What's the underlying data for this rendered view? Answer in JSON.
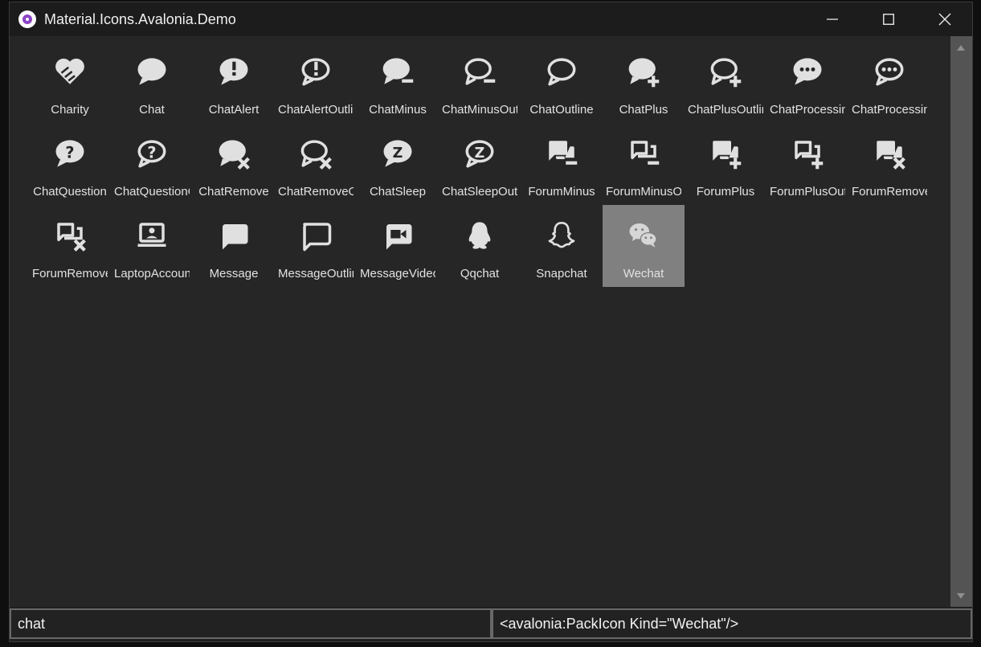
{
  "window": {
    "title": "Material.Icons.Avalonia.Demo",
    "controls": [
      "minimize",
      "maximize",
      "close"
    ]
  },
  "icons": [
    {
      "label": "Charity",
      "icon": "charity-icon"
    },
    {
      "label": "Chat",
      "icon": "chat-icon"
    },
    {
      "label": "ChatAlert",
      "icon": "chat-alert-icon"
    },
    {
      "label": "ChatAlertOutline",
      "icon": "chat-alert-outline-icon"
    },
    {
      "label": "ChatMinus",
      "icon": "chat-minus-icon"
    },
    {
      "label": "ChatMinusOutline",
      "icon": "chat-minus-outline-icon"
    },
    {
      "label": "ChatOutline",
      "icon": "chat-outline-icon"
    },
    {
      "label": "ChatPlus",
      "icon": "chat-plus-icon"
    },
    {
      "label": "ChatPlusOutline",
      "icon": "chat-plus-outline-icon"
    },
    {
      "label": "ChatProcessing",
      "icon": "chat-processing-icon"
    },
    {
      "label": "ChatProcessingOutline",
      "icon": "chat-processing-outline-icon"
    },
    {
      "label": "ChatQuestion",
      "icon": "chat-question-icon"
    },
    {
      "label": "ChatQuestionOutline",
      "icon": "chat-question-outline-icon"
    },
    {
      "label": "ChatRemove",
      "icon": "chat-remove-icon"
    },
    {
      "label": "ChatRemoveOutline",
      "icon": "chat-remove-outline-icon"
    },
    {
      "label": "ChatSleep",
      "icon": "chat-sleep-icon"
    },
    {
      "label": "ChatSleepOutline",
      "icon": "chat-sleep-outline-icon"
    },
    {
      "label": "ForumMinus",
      "icon": "forum-minus-icon"
    },
    {
      "label": "ForumMinusOutline",
      "icon": "forum-minus-outline-icon"
    },
    {
      "label": "ForumPlus",
      "icon": "forum-plus-icon"
    },
    {
      "label": "ForumPlusOutline",
      "icon": "forum-plus-outline-icon"
    },
    {
      "label": "ForumRemove",
      "icon": "forum-remove-icon"
    },
    {
      "label": "ForumRemoveOutline",
      "icon": "forum-remove-outline-icon"
    },
    {
      "label": "LaptopAccount",
      "icon": "laptop-account-icon"
    },
    {
      "label": "Message",
      "icon": "message-icon"
    },
    {
      "label": "MessageOutline",
      "icon": "message-outline-icon"
    },
    {
      "label": "MessageVideo",
      "icon": "message-video-icon"
    },
    {
      "label": "Qqchat",
      "icon": "qqchat-icon"
    },
    {
      "label": "Snapchat",
      "icon": "snapchat-icon"
    },
    {
      "label": "Wechat",
      "icon": "wechat-icon",
      "selected": true
    }
  ],
  "search": {
    "value": "chat"
  },
  "code_output": {
    "value": "<avalonia:PackIcon Kind=\"Wechat\"/>"
  },
  "colors": {
    "background": "#262626",
    "titlebar": "#1c1c1c",
    "icon": "#e0e0e0",
    "selected_tile": "#808080"
  }
}
